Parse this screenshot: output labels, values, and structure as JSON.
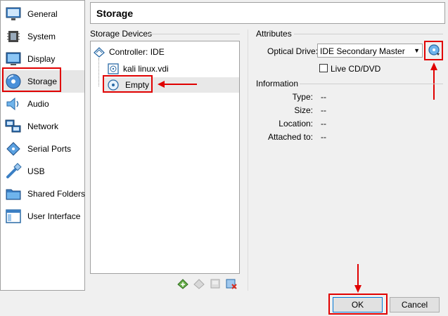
{
  "sidebar": {
    "items": [
      {
        "label": "General",
        "icon": "monitor-icon"
      },
      {
        "label": "System",
        "icon": "chip-icon"
      },
      {
        "label": "Display",
        "icon": "display-icon"
      },
      {
        "label": "Storage",
        "icon": "disk-icon"
      },
      {
        "label": "Audio",
        "icon": "speaker-icon"
      },
      {
        "label": "Network",
        "icon": "network-icon"
      },
      {
        "label": "Serial Ports",
        "icon": "serial-port-icon"
      },
      {
        "label": "USB",
        "icon": "usb-icon"
      },
      {
        "label": "Shared Folders",
        "icon": "folder-icon"
      },
      {
        "label": "User Interface",
        "icon": "window-icon"
      }
    ],
    "selected": "Storage"
  },
  "header": {
    "title": "Storage"
  },
  "storage_devices": {
    "group_label": "Storage Devices",
    "controller": "Controller: IDE",
    "disk": "kali linux.vdi",
    "optical": "Empty"
  },
  "attributes": {
    "group_label": "Attributes",
    "optical_drive_label": "Optical Drive:",
    "optical_drive_value": "IDE Secondary Master",
    "live_cd_label": "Live CD/DVD",
    "live_cd_checked": false
  },
  "information": {
    "group_label": "Information",
    "rows": [
      {
        "key": "Type:",
        "value": "--"
      },
      {
        "key": "Size:",
        "value": "--"
      },
      {
        "key": "Location:",
        "value": "--"
      },
      {
        "key": "Attached to:",
        "value": "--"
      }
    ]
  },
  "buttons": {
    "ok": "OK",
    "cancel": "Cancel"
  },
  "colors": {
    "highlight_red": "#e00000",
    "selected_bg": "#e6e6e6"
  }
}
